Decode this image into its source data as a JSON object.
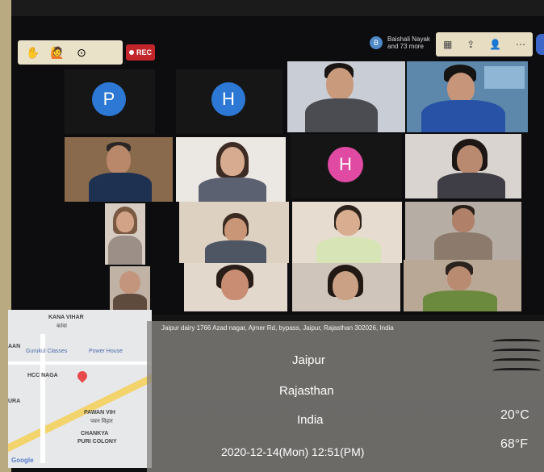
{
  "toolbar": {
    "left_icons": [
      "raise-hand-icon",
      "reaction-icon",
      "settings-icon"
    ],
    "rec_label": "REC",
    "participants_label": "Baishali Nayak and 73 more",
    "participants_initial": "B",
    "right_icons": [
      "gallery-view-icon",
      "share-icon",
      "participants-icon",
      "more-icon"
    ]
  },
  "tiles": {
    "p_initial": "P",
    "h1_initial": "H",
    "h2_initial": "H"
  },
  "map": {
    "labels": {
      "kana": "KANA VIHAR",
      "gurudwara": "कांवा",
      "classes": "Gurukul Classes",
      "power": "Power House",
      "aan": "AAN",
      "hcc": "HCC NAGA",
      "pawan": "PAWAN VIH",
      "pawan_hi": "पवन विहार",
      "chankya": "CHANKYA",
      "puri": "PURI COLONY",
      "ura": "URA",
      "google": "Google"
    }
  },
  "overlay": {
    "address": "Jaipur dairy 1766 Azad nagar, Ajmer Rd, bypass, Jaipur, Rajasthan 302026, India",
    "city": "Jaipur",
    "state": "Rajasthan",
    "country": "India",
    "datetime": "2020-12-14(Mon)   12:51(PM)",
    "temp_c": "20°C",
    "temp_f": "68°F"
  }
}
